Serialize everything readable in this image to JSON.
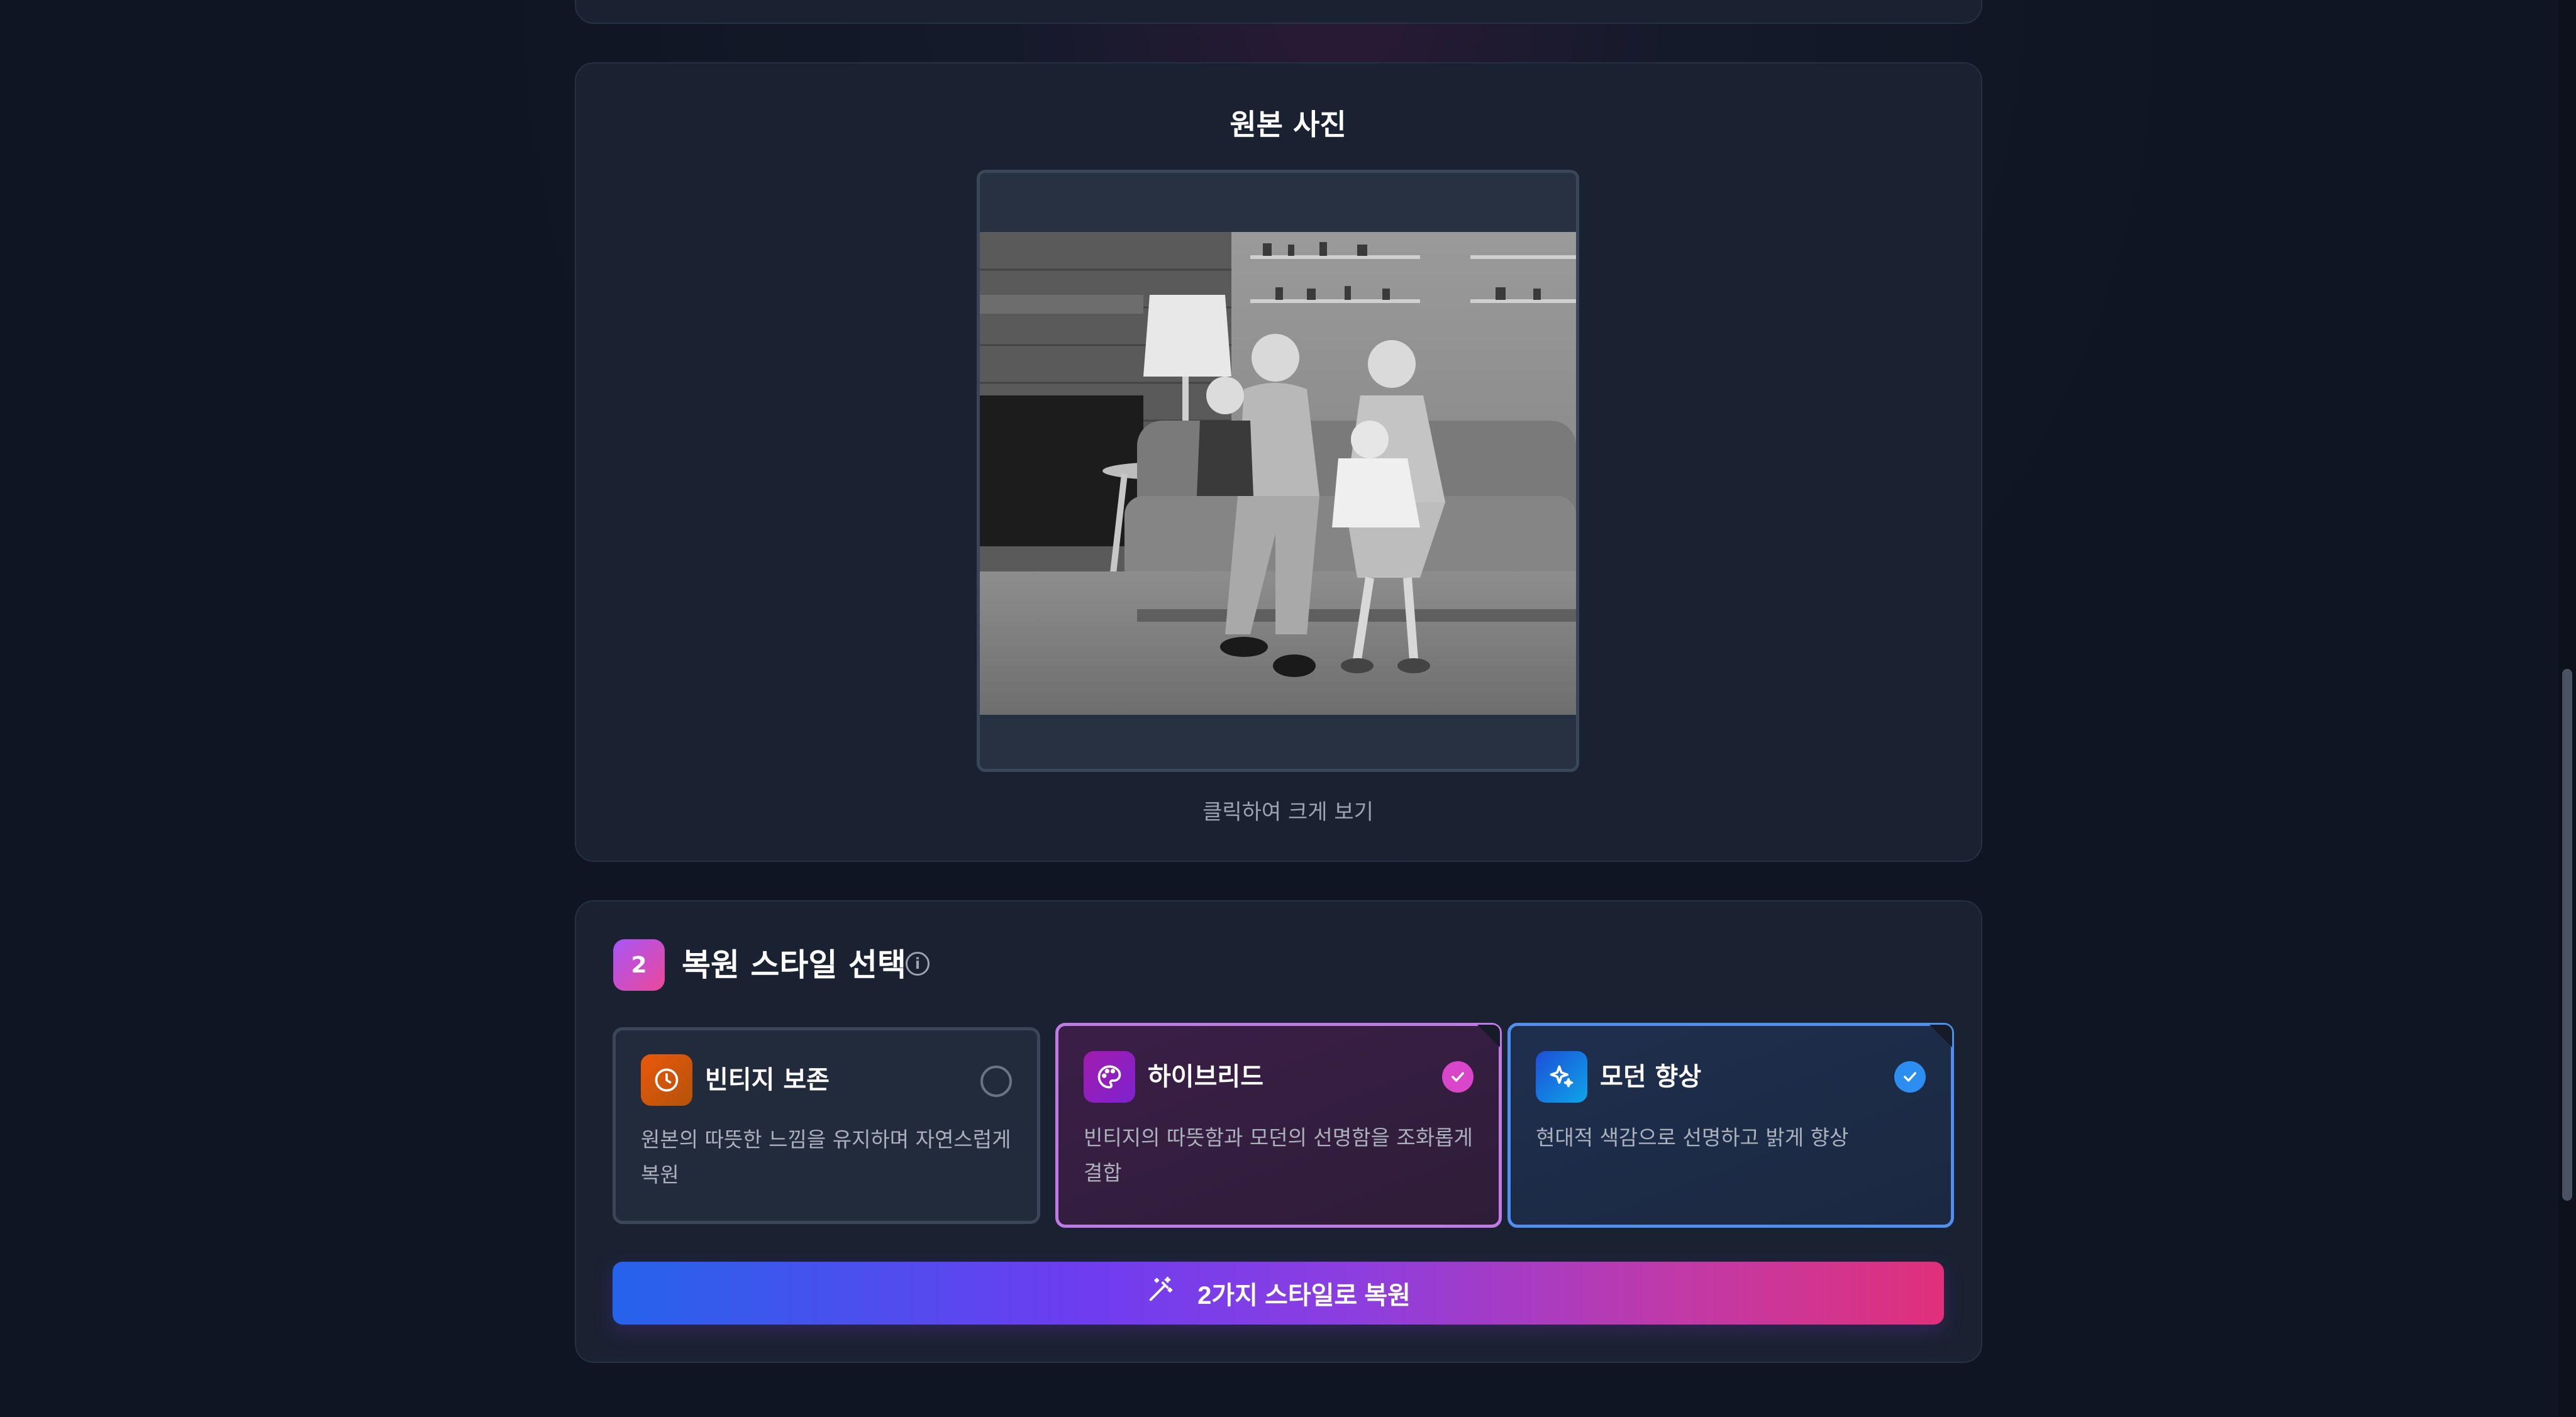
{
  "photo_section": {
    "title": "원본 사진",
    "hint": "클릭하여 크게 보기"
  },
  "style_section": {
    "step": "2",
    "title": "복원 스타일 선택",
    "options": [
      {
        "title": "빈티지 보존",
        "description": "원본의 따뜻한 느낌을 유지하며 자연스럽게 복원",
        "selected": false,
        "icon": "clock-icon",
        "color": "#ea580c"
      },
      {
        "title": "하이브리드",
        "description": "빈티지의 따뜻함과 모던의 선명함을 조화롭게 결합",
        "selected": true,
        "icon": "palette-icon",
        "color": "#c07ae6"
      },
      {
        "title": "모던 향상",
        "description": "현대적 색감으로 선명하고 밝게 향상",
        "selected": true,
        "icon": "sparkles-icon",
        "color": "#4f8ff0"
      }
    ],
    "restore_button": "2가지 스타일로 복원"
  }
}
